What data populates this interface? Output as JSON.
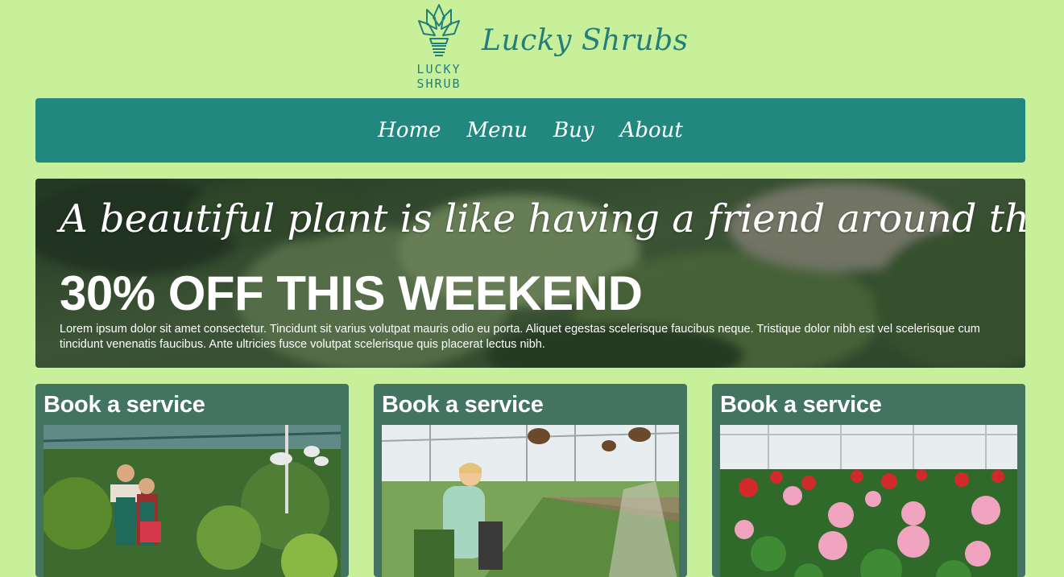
{
  "brand": {
    "logo_line1": "LUCKY",
    "logo_line2": "SHRUB",
    "name": "Lucky Shrubs"
  },
  "nav": {
    "items": [
      {
        "label": "Home"
      },
      {
        "label": "Menu"
      },
      {
        "label": "Buy"
      },
      {
        "label": "About"
      }
    ]
  },
  "hero": {
    "quote": "A beautiful plant is like having a friend around the house.",
    "offer": "30% OFF THIS WEEKEND",
    "body": "Lorem ipsum dolor sit amet consectetur. Tincidunt sit varius volutpat mauris odio eu porta. Aliquet egestas scelerisque faucibus neque. Tristique dolor nibh est vel scelerisque cum tincidunt venenatis faucibus. Ante ultricies fusce volutpat scelerisque quis placerat lectus nibh."
  },
  "cards": [
    {
      "title": "Book a service",
      "image": "greenhouse-couple-photo"
    },
    {
      "title": "Book a service",
      "image": "greenhouse-gardener-photo"
    },
    {
      "title": "Book a service",
      "image": "greenhouse-geraniums-photo"
    }
  ],
  "colors": {
    "page_bg": "#c8f09a",
    "brand": "#237f7a",
    "nav_bg": "#22877e",
    "card_bg": "#437361"
  }
}
